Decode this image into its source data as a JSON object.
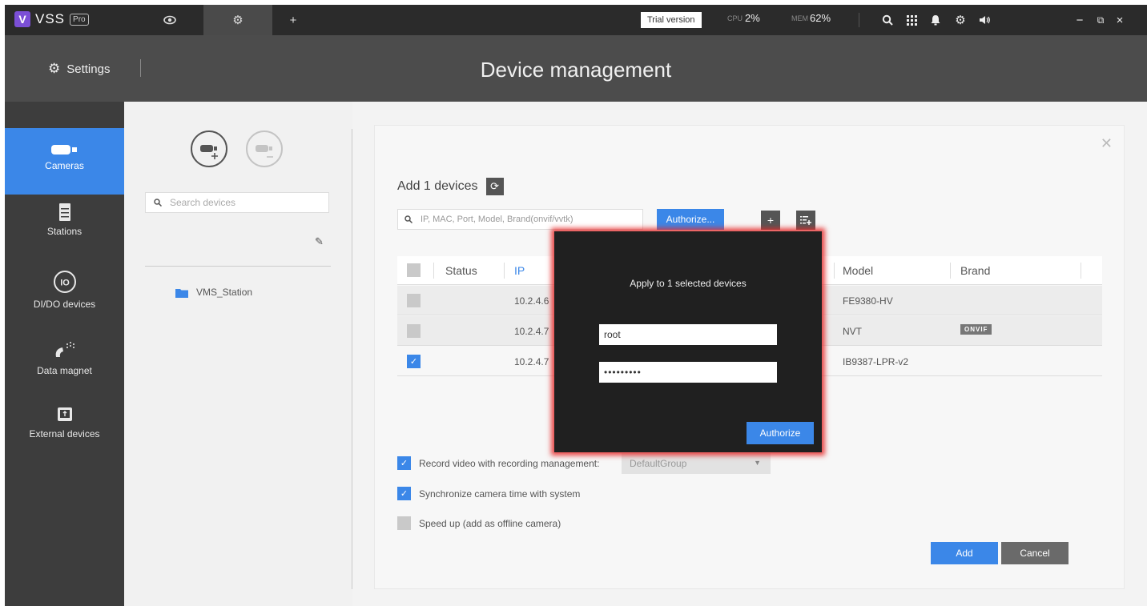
{
  "app": {
    "brand": "VSS",
    "edition": "Pro"
  },
  "topbar": {
    "trial_label": "Trial version",
    "cpu_label": "CPU",
    "cpu_value": "2%",
    "mem_label": "MEM",
    "mem_value": "62%",
    "new_tab": "+",
    "window_minimize": "−",
    "window_restore": "⧉",
    "window_close": "×"
  },
  "header": {
    "settings_label": "Settings",
    "page_title": "Device management"
  },
  "sidebar": {
    "items": [
      {
        "label": "Cameras",
        "icon": "camera-icon",
        "active": true
      },
      {
        "label": "Stations",
        "icon": "server-icon",
        "active": false
      },
      {
        "label": "DI/DO devices",
        "icon": "io-icon",
        "active": false
      },
      {
        "label": "Data magnet",
        "icon": "data-magnet-icon",
        "active": false
      },
      {
        "label": "External devices",
        "icon": "usb-device-icon",
        "active": false
      }
    ]
  },
  "device_tree": {
    "search_placeholder": "Search devices",
    "station_name": "VMS_Station"
  },
  "add_dialog": {
    "title": "Add 1 devices",
    "filter_placeholder": "IP, MAC, Port, Model, Brand(onvif/vvtk)",
    "authorize_label": "Authorize...",
    "columns": [
      "Status",
      "IP",
      "Model",
      "Brand"
    ],
    "rows": [
      {
        "checked": false,
        "status": "",
        "ip": "10.2.4.6",
        "model": "FE9380-HV",
        "brand": ""
      },
      {
        "checked": false,
        "status": "",
        "ip": "10.2.4.7",
        "model": "NVT",
        "brand": "ONVIF"
      },
      {
        "checked": true,
        "status": "",
        "ip": "10.2.4.7",
        "model": "IB9387-LPR-v2",
        "brand": ""
      }
    ],
    "options": {
      "record_label": "Record video with recording management:",
      "record_checked": true,
      "record_group": "DefaultGroup",
      "sync_label": "Synchronize camera time with system",
      "sync_checked": true,
      "speedup_label": "Speed up (add as offline camera)",
      "speedup_checked": false
    },
    "add_label": "Add",
    "cancel_label": "Cancel"
  },
  "authorize_popup": {
    "title": "Apply to 1 selected devices",
    "username": "root",
    "password": "•••••••••",
    "button_label": "Authorize"
  },
  "colors": {
    "accent": "#3b87e8",
    "topbar": "#2b2b2b",
    "titlebar": "#4c4c4c",
    "sidebar": "#3d3d3d",
    "popup": "#202020",
    "popup_glow": "#e62828"
  }
}
